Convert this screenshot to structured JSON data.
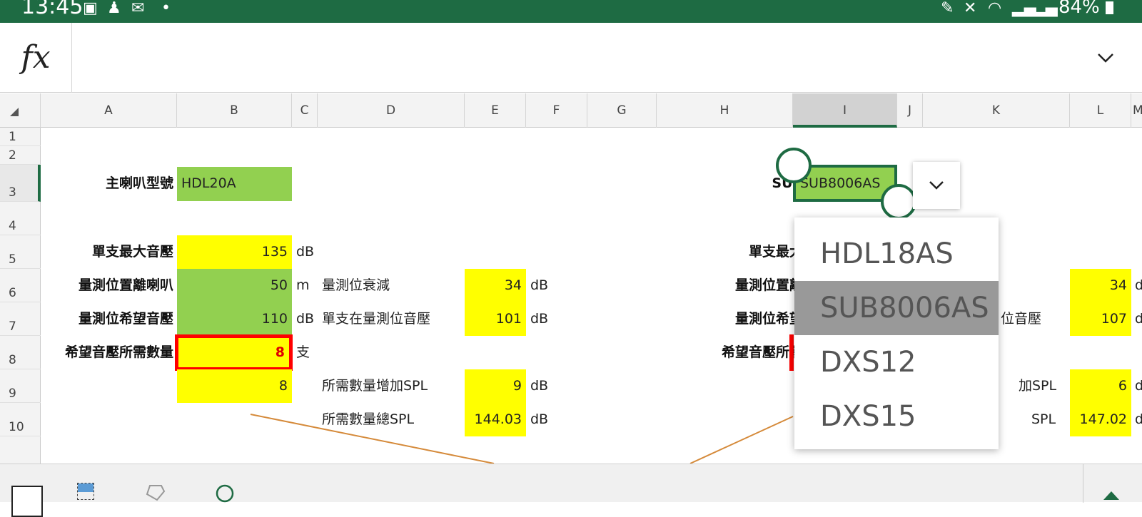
{
  "status_bar": {
    "time": "13:45",
    "battery": "84%",
    "notification_icons": [
      "image-icon",
      "person-icon",
      "mail-icon",
      "dot-icon"
    ],
    "system_icons": [
      "pen-icon",
      "mute-icon",
      "wifi-icon",
      "signal-icon",
      "signal-icon",
      "battery-icon"
    ]
  },
  "formula_bar": {
    "fx_label": "fx",
    "content": ""
  },
  "columns": [
    "A",
    "B",
    "C",
    "D",
    "E",
    "F",
    "G",
    "H",
    "I",
    "J",
    "K",
    "L",
    "M"
  ],
  "selected_column": "I",
  "rows": [
    "1",
    "2",
    "3",
    "4",
    "5",
    "6",
    "7",
    "8",
    "9",
    "10"
  ],
  "selected_row": "3",
  "sheet": {
    "main_model_label": "主喇叭型號",
    "main_model_value": "HDL20A",
    "max_spl_label": "單支最大音壓",
    "max_spl_value": "135",
    "unit_db": "dB",
    "distance_label": "量測位置離喇叭",
    "distance_value": "50",
    "unit_m": "m",
    "attenuation_label": "量測位衰減",
    "attenuation_value": "34",
    "desired_spl_label": "量測位希望音壓",
    "desired_spl_value": "110",
    "single_at_pos_label": "單支在量測位音壓",
    "single_at_pos_value": "101",
    "qty_needed_label": "希望音壓所需數量",
    "qty_needed_value": "8",
    "unit_pcs": "支",
    "qty_value_b9": "8",
    "qty_increase_label": "所需數量增加SPL",
    "qty_increase_value": "9",
    "total_spl_label": "所需數量總SPL",
    "total_spl_value": "144.03",
    "sub_model_label": "SUB型號",
    "sub_model_value": "SUB8006AS",
    "sub_max_spl_label": "單支最大音壓",
    "sub_distance_label": "量測位置離喇叭",
    "sub_desired_spl_label": "量測位希望音壓",
    "sub_qty_needed_label": "希望音壓所需數量",
    "sub_l6_value": "34",
    "sub_l7_value": "107",
    "sub_l9_value": "6",
    "sub_l10_value": "147.02",
    "partial_k7": "位音壓",
    "partial_k9": "加SPL",
    "partial_k10": "SPL",
    "partial_m6": "d",
    "partial_m7": "d",
    "partial_m9": "d",
    "partial_m10": "d"
  },
  "dropdown": {
    "options": [
      "HDL18AS",
      "SUB8006AS",
      "DXS12",
      "DXS15"
    ],
    "selected": "SUB8006AS"
  },
  "colors": {
    "status_bar": "#1e6b43",
    "green_cell": "#92d050",
    "yellow_cell": "#ffff00",
    "error_border": "#ff0000",
    "line": "#d58a3a"
  },
  "toolbar": {
    "icons": [
      "border-icon",
      "fill-color-icon",
      "format-painter-icon",
      "comment-icon",
      "expand-up-icon"
    ]
  }
}
